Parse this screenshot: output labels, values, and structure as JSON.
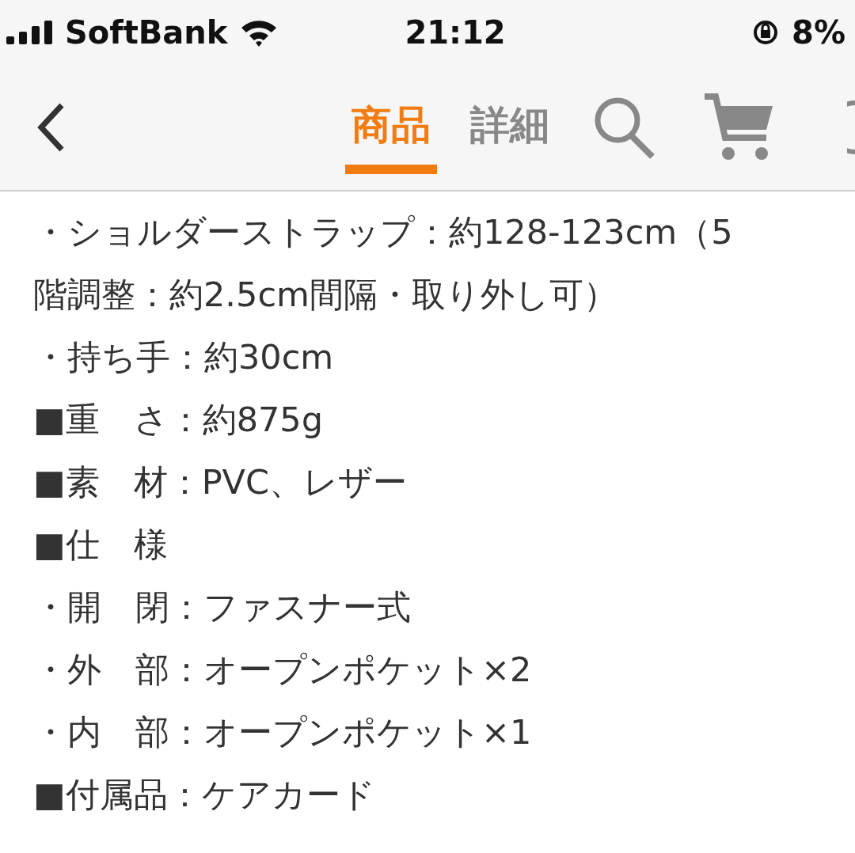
{
  "status_bar": {
    "carrier": "SoftBank",
    "time": "21:12",
    "battery": "8%"
  },
  "tabs": [
    {
      "label": "商品",
      "selected": true
    },
    {
      "label": "詳細",
      "selected": false
    }
  ],
  "lines": [
    "・ショルダーストラップ：約128-123cm（5",
    "階調整：約2.5cm間隔・取り外し可）",
    "・持ち手：約30cm",
    "■重　さ：約875g",
    "■素　材：PVC、レザー",
    "■仕　様",
    "・開　閉：ファスナー式",
    "・外　部：オープンポケット×2",
    "・内　部：オープンポケット×1",
    "■付属品：ケアカード"
  ]
}
